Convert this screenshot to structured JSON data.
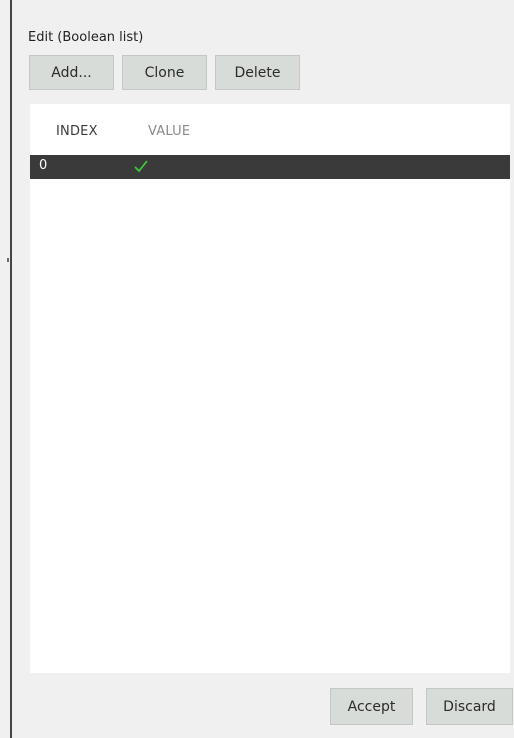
{
  "dialog": {
    "title": "Edit  (Boolean list)"
  },
  "toolbar": {
    "add_label": "Add...",
    "clone_label": "Clone",
    "delete_label": "Delete"
  },
  "table": {
    "columns": [
      "INDEX",
      "VALUE"
    ],
    "rows": [
      {
        "index": "0",
        "value": true,
        "value_icon": "checkmark-icon",
        "selected": true
      }
    ]
  },
  "footer": {
    "accept_label": "Accept",
    "discard_label": "Discard"
  },
  "colors": {
    "selected_row_bg": "#3a3a3a",
    "check_color": "#3cd23c",
    "button_bg": "#d8dcd8",
    "panel_bg": "#f0f0f0"
  }
}
